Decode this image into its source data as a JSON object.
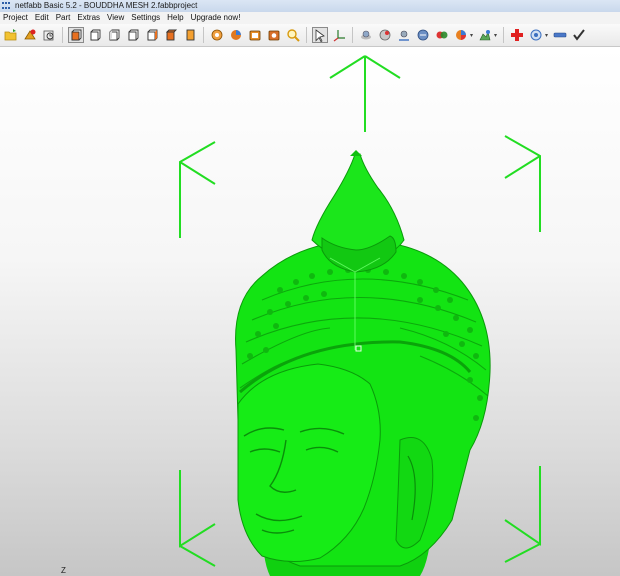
{
  "window": {
    "title": "netfabb Basic 5.2 - BOUDDHA MESH 2.fabbproject"
  },
  "menu": {
    "items": [
      "Project",
      "Edit",
      "Part",
      "Extras",
      "View",
      "Settings",
      "Help",
      "Upgrade now!"
    ]
  },
  "toolbar": {
    "icons": [
      "open-folder-icon",
      "add-part-icon",
      "undo-history-icon",
      "view-front-icon",
      "view-back-icon",
      "view-left-icon",
      "view-right-icon",
      "view-top-icon",
      "view-bottom-icon",
      "repair-icon",
      "analysis-icon",
      "slice-icon",
      "measure-icon",
      "zoom-icon",
      "select-icon",
      "coordinate-icon",
      "shell-icon",
      "rotate-icon",
      "scale-icon",
      "mirror-icon",
      "duplicate-icon",
      "color-icon",
      "render-icon",
      "add-icon",
      "settings-icon",
      "remove-icon",
      "check-icon"
    ],
    "selected_view": "view-front-icon"
  },
  "viewport": {
    "axis_label": "Z",
    "model_name": "BOUDDHA MESH 2",
    "model_color": "#11e611",
    "bounding_box_color": "#22dd22"
  }
}
